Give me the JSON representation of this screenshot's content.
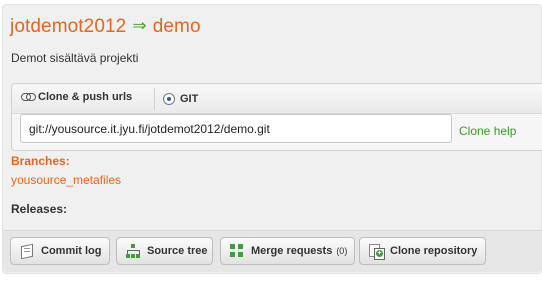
{
  "project": {
    "owner": "jotdemot2012",
    "arrow": "⇒",
    "name": "demo",
    "description": "Demot sisältävä projekti"
  },
  "clone": {
    "tab_urls_label": "Clone & push urls",
    "tab_git_label": "GIT",
    "url_value": "git://yousource.it.jyu.fi/jotdemot2012/demo.git",
    "help_label": "Clone help"
  },
  "branches": {
    "label": "Branches:",
    "items": [
      "yousource_metafiles"
    ]
  },
  "releases": {
    "label": "Releases:"
  },
  "toolbar": {
    "commit_log_label": "Commit log",
    "source_tree_label": "Source tree",
    "merge_requests_label": "Merge requests",
    "merge_requests_count": "(0)",
    "clone_repository_label": "Clone repository"
  },
  "icons": {
    "urls_tab": "chain-link-icon",
    "git_tab": "radio-selected-icon",
    "commit_log": "commit-icon",
    "source_tree": "tree-icon",
    "merge_requests": "merge-icon",
    "clone_repository": "clone-icon"
  },
  "colors": {
    "accent_orange": "#e8651c",
    "accent_green": "#3a9a2a",
    "panel_bg": "#f0f0f0"
  }
}
